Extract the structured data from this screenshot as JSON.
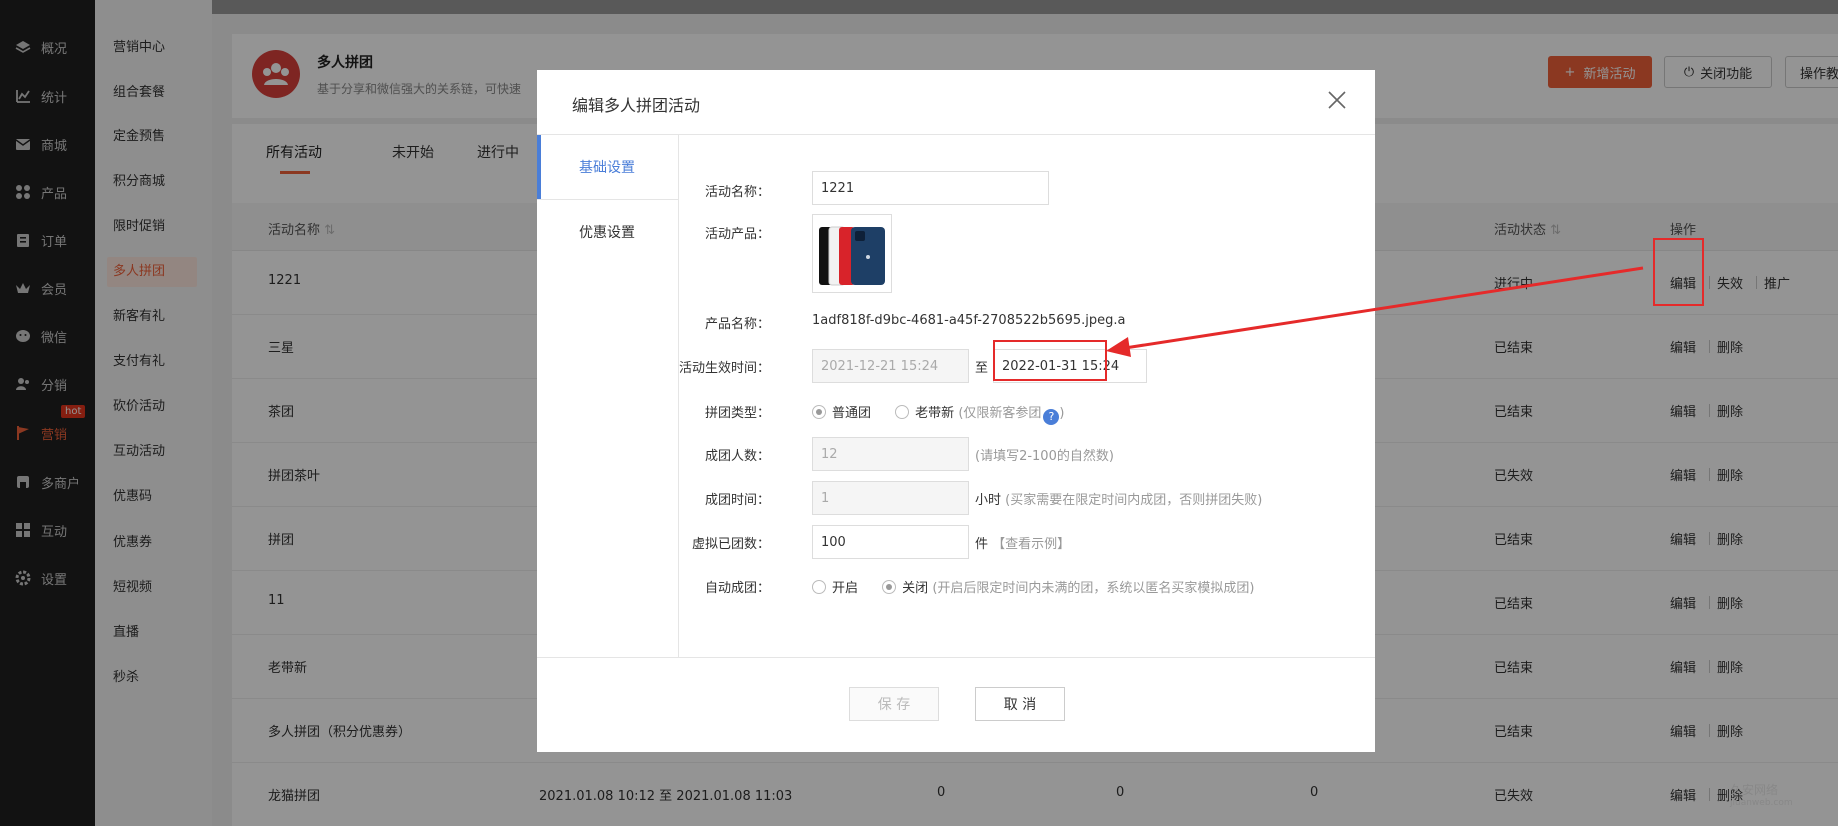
{
  "left_nav": [
    {
      "label": "概况",
      "icon": "layers-icon"
    },
    {
      "label": "统计",
      "icon": "chart-icon"
    },
    {
      "label": "商城",
      "icon": "mail-icon"
    },
    {
      "label": "产品",
      "icon": "grid-icon"
    },
    {
      "label": "订单",
      "icon": "clipboard-icon"
    },
    {
      "label": "会员",
      "icon": "crown-icon"
    },
    {
      "label": "微信",
      "icon": "wechat-icon"
    },
    {
      "label": "分销",
      "icon": "users-icon"
    },
    {
      "label": "营销",
      "icon": "flag-icon",
      "badge": "hot",
      "active": true
    },
    {
      "label": "多商户",
      "icon": "shop-icon"
    },
    {
      "label": "互动",
      "icon": "apps-icon"
    },
    {
      "label": "设置",
      "icon": "gear-icon"
    }
  ],
  "sub_nav": [
    "营销中心",
    "组合套餐",
    "定金预售",
    "积分商城",
    "限时促销",
    "多人拼团",
    "新客有礼",
    "支付有礼",
    "砍价活动",
    "互动活动",
    "优惠码",
    "优惠券",
    "短视频",
    "直播",
    "秒杀"
  ],
  "sub_nav_active": "多人拼团",
  "header": {
    "title": "多人拼团",
    "desc": "基于分享和微信强大的关系链，可快速",
    "new_btn": "新增活动",
    "close_btn": "关闭功能",
    "ops_btn": "操作教"
  },
  "tabs": [
    "所有活动",
    "未开始",
    "进行中"
  ],
  "table": {
    "headers": {
      "name": "活动名称",
      "status": "活动状态",
      "ops": "操作"
    },
    "rows": [
      {
        "name": "1221",
        "time": "",
        "c1": "",
        "c2": "",
        "c3": "",
        "status": "进行中",
        "ops": [
          "编辑",
          "失效",
          "推广"
        ]
      },
      {
        "name": "三星",
        "time": "",
        "c1": "",
        "c2": "",
        "c3": "",
        "status": "已结束",
        "ops": [
          "编辑",
          "删除"
        ]
      },
      {
        "name": "茶团",
        "time": "",
        "c1": "",
        "c2": "",
        "c3": "",
        "status": "已结束",
        "ops": [
          "编辑",
          "删除"
        ]
      },
      {
        "name": "拼团茶叶",
        "time": "",
        "c1": "",
        "c2": "",
        "c3": "",
        "status": "已失效",
        "ops": [
          "编辑",
          "删除"
        ]
      },
      {
        "name": "拼团",
        "time": "",
        "c1": "",
        "c2": "",
        "c3": "",
        "status": "已结束",
        "ops": [
          "编辑",
          "删除"
        ]
      },
      {
        "name": "11",
        "time": "",
        "c1": "",
        "c2": "",
        "c3": "",
        "status": "已结束",
        "ops": [
          "编辑",
          "删除"
        ]
      },
      {
        "name": "老带新",
        "time": "",
        "c1": "",
        "c2": "",
        "c3": "",
        "status": "已结束",
        "ops": [
          "编辑",
          "删除"
        ]
      },
      {
        "name": "多人拼团（积分优惠券）",
        "time": "",
        "c1": "",
        "c2": "",
        "c3": "",
        "status": "已结束",
        "ops": [
          "编辑",
          "删除"
        ]
      },
      {
        "name": "龙猫拼团",
        "time": "2021.01.08 10:12 至 2021.01.08 11:03",
        "c1": "0",
        "c2": "0",
        "c3": "0",
        "status": "已失效",
        "ops": [
          "编辑",
          "删除"
        ]
      }
    ]
  },
  "modal": {
    "title": "编辑多人拼团活动",
    "side_tabs": [
      "基础设置",
      "优惠设置"
    ],
    "fields": {
      "name_label": "活动名称：",
      "name_value": "1221",
      "product_label": "活动产品：",
      "product_name_label": "产品名称：",
      "product_name_value": "1adf818f-d9bc-4681-a45f-2708522b5695.jpeg.a",
      "time_label": "活动生效时间：",
      "time_start": "2021-12-21 15:24",
      "time_to": "至",
      "time_end": "2022-01-31 15:24",
      "type_label": "拼团类型：",
      "type_opt1": "普通团",
      "type_opt2": "老带新",
      "type_hint": "(仅限新客参团",
      "type_hint_end": ")",
      "size_label": "成团人数：",
      "size_value": "12",
      "size_hint": "(请填写2-100的自然数)",
      "dur_label": "成团时间：",
      "dur_value": "1",
      "dur_unit": "小时",
      "dur_hint": "(买家需要在限定时间内成团，否则拼团失败)",
      "virt_label": "虚拟已团数：",
      "virt_value": "100",
      "virt_unit": "件",
      "virt_link": "【查看示例】",
      "auto_label": "自动成团：",
      "auto_on": "开启",
      "auto_off": "关闭",
      "auto_hint": "(开启后限定时间内未满的团，系统以匿名买家模拟成团)"
    },
    "save_btn": "保 存",
    "cancel_btn": "取 消"
  },
  "watermark": {
    "line1": "久安网络",
    "line2": "jiuanweb.com"
  },
  "colors": {
    "accent": "#f0613a",
    "blue": "#4a7ed8",
    "annotation": "#e52a2a"
  }
}
